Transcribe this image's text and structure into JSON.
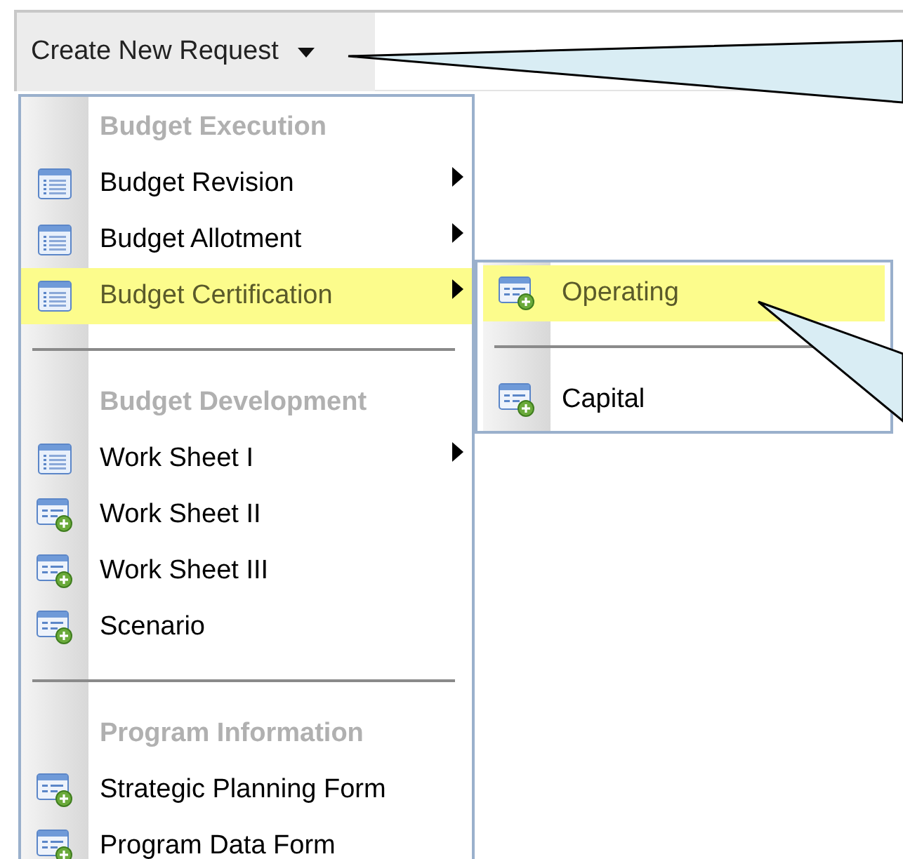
{
  "toolbar": {
    "button": {
      "label": "Create New Request"
    }
  },
  "menu": {
    "items": [
      {
        "kind": "header",
        "label": "Budget Execution"
      },
      {
        "kind": "list",
        "label": "Budget Revision",
        "has_submenu": true,
        "selected": false
      },
      {
        "kind": "list",
        "label": "Budget Allotment",
        "has_submenu": true,
        "selected": false
      },
      {
        "kind": "list",
        "label": "Budget Certification",
        "has_submenu": true,
        "selected": true
      },
      {
        "kind": "separator"
      },
      {
        "kind": "header",
        "label": "Budget Development"
      },
      {
        "kind": "list",
        "label": "Work Sheet I",
        "has_submenu": true,
        "selected": false
      },
      {
        "kind": "form",
        "label": "Work Sheet II",
        "has_submenu": false,
        "selected": false
      },
      {
        "kind": "form",
        "label": "Work Sheet III",
        "has_submenu": false,
        "selected": false
      },
      {
        "kind": "form",
        "label": "Scenario",
        "has_submenu": false,
        "selected": false
      },
      {
        "kind": "separator"
      },
      {
        "kind": "header",
        "label": "Program Information"
      },
      {
        "kind": "form",
        "label": "Strategic Planning Form",
        "has_submenu": false,
        "selected": false
      },
      {
        "kind": "form",
        "label": "Program Data Form",
        "has_submenu": false,
        "selected": false
      }
    ]
  },
  "submenu": {
    "items": [
      {
        "kind": "form",
        "label": "Operating",
        "selected": true
      },
      {
        "kind": "separator"
      },
      {
        "kind": "form",
        "label": "Capital",
        "selected": false
      }
    ]
  }
}
